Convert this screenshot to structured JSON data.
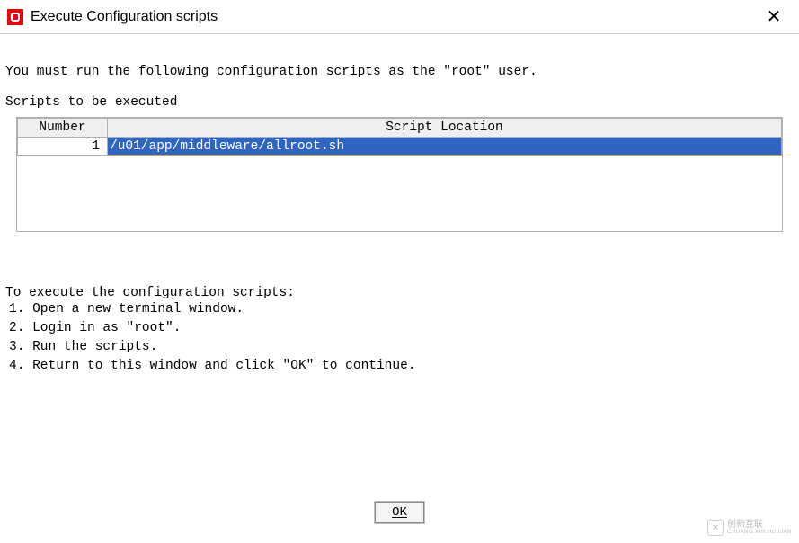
{
  "window": {
    "title": "Execute Configuration scripts"
  },
  "instruction": "You must run the following configuration scripts as the \"root\" user.",
  "section_label": "Scripts to be executed",
  "table": {
    "headers": {
      "number": "Number",
      "location": "Script Location"
    },
    "rows": [
      {
        "number": "1",
        "location": "/u01/app/middleware/allroot.sh"
      }
    ]
  },
  "steps": {
    "heading": "To execute the configuration scripts:",
    "items": [
      "1. Open a new  terminal window.",
      "2. Login in as \"root\".",
      "3. Run the scripts.",
      "4. Return to this window and click \"OK\" to continue."
    ]
  },
  "buttons": {
    "ok": "OK"
  },
  "watermark": {
    "main": "创新互联",
    "sub": "CHUANG.XIN.HU.LIAN"
  }
}
